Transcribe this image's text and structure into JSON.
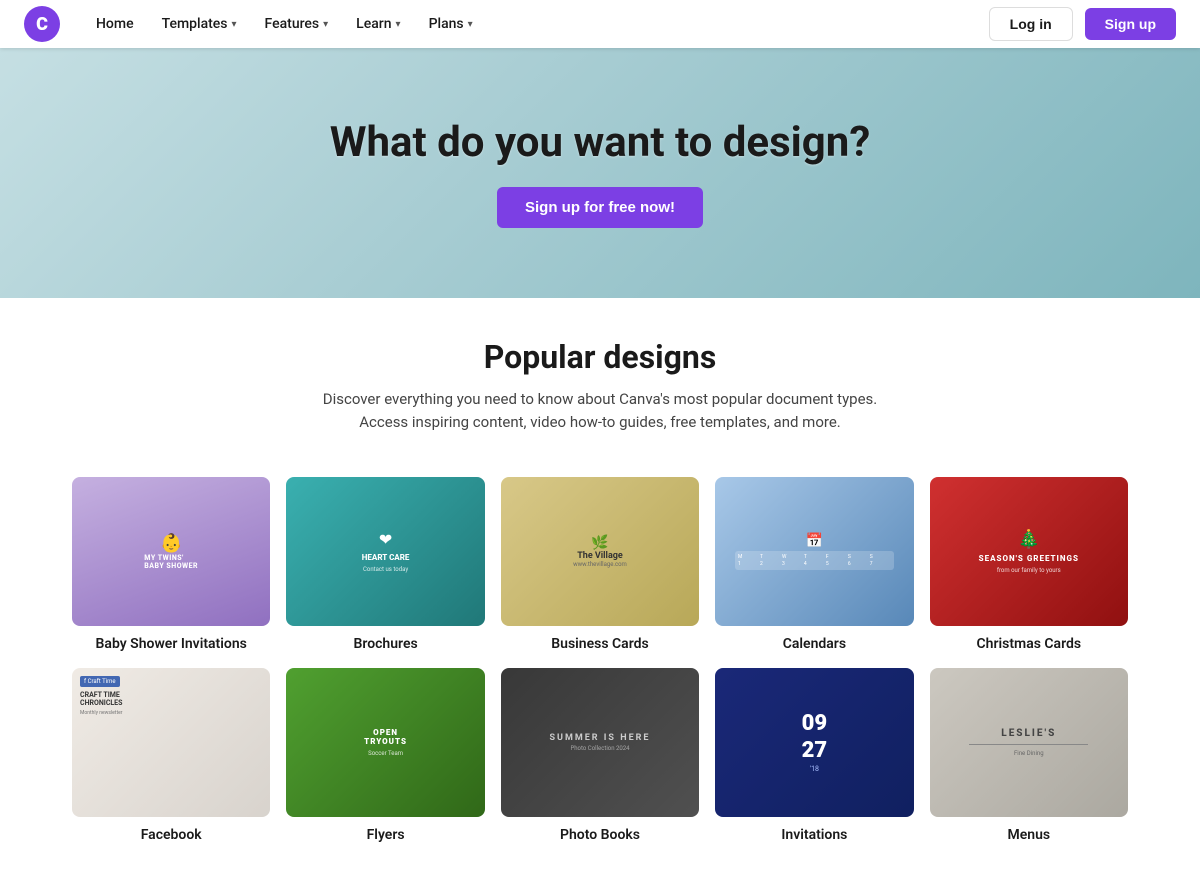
{
  "nav": {
    "logo_letter": "C",
    "home_label": "Home",
    "templates_label": "Templates",
    "features_label": "Features",
    "learn_label": "Learn",
    "plans_label": "Plans",
    "login_label": "Log in",
    "signup_label": "Sign up"
  },
  "hero": {
    "title": "What do you want to design?",
    "cta_label": "Sign up for free now!"
  },
  "popular": {
    "title": "Popular designs",
    "description": "Discover everything you need to know about Canva's most popular document types. Access inspiring content, video how-to guides, free templates, and more."
  },
  "templates": {
    "row1": [
      {
        "id": "baby-shower",
        "label": "Baby Shower Invitations",
        "type": "baby"
      },
      {
        "id": "brochures",
        "label": "Brochures",
        "type": "brochure"
      },
      {
        "id": "business-cards",
        "label": "Business Cards",
        "type": "business"
      },
      {
        "id": "calendars",
        "label": "Calendars",
        "type": "calendar"
      },
      {
        "id": "christmas-cards",
        "label": "Christmas Cards",
        "type": "christmas"
      }
    ],
    "row2": [
      {
        "id": "facebook",
        "label": "Facebook",
        "type": "facebook"
      },
      {
        "id": "flyers",
        "label": "Flyers",
        "type": "flyer"
      },
      {
        "id": "photo-books",
        "label": "Photo Books",
        "type": "album"
      },
      {
        "id": "invitations",
        "label": "Invitations",
        "type": "invite"
      },
      {
        "id": "menus",
        "label": "Menus",
        "type": "menu"
      }
    ]
  }
}
